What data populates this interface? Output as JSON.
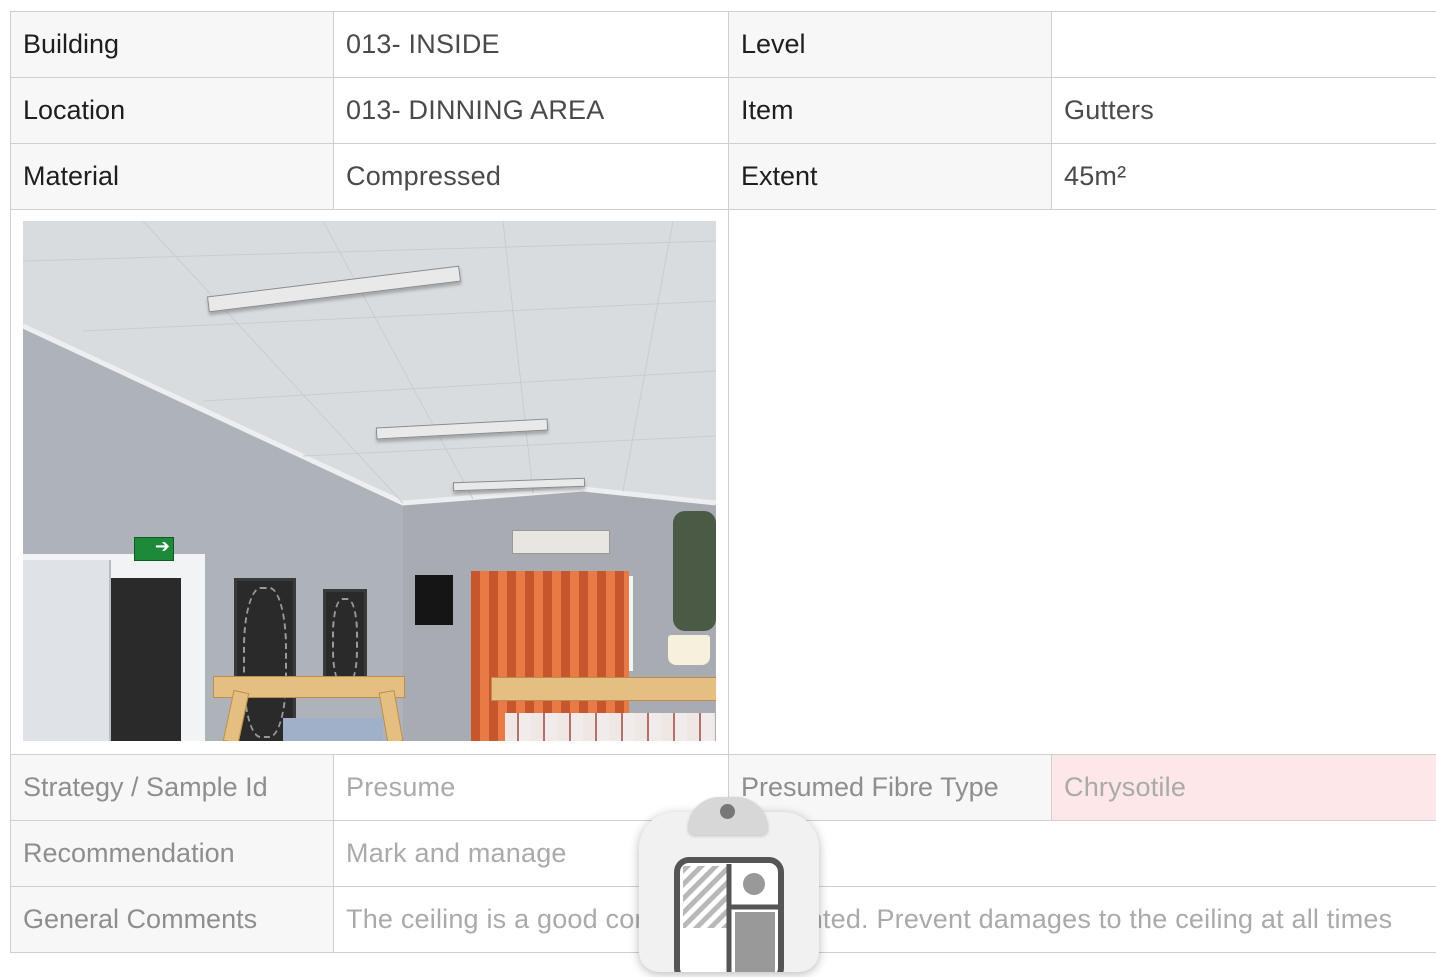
{
  "rows": {
    "building": {
      "label": "Building",
      "value": "013- INSIDE"
    },
    "level": {
      "label": "Level",
      "value": ""
    },
    "location": {
      "label": "Location",
      "value": "013- DINNING AREA"
    },
    "item": {
      "label": "Item",
      "value": "Gutters"
    },
    "material": {
      "label": "Material",
      "value": "Compressed"
    },
    "extent": {
      "label": "Extent",
      "value": "45m²"
    },
    "strategy": {
      "label": "Strategy / Sample Id",
      "value": "Presume"
    },
    "fibre_type": {
      "label": "Presumed Fibre Type",
      "value": "Chrysotile"
    },
    "recommendation": {
      "label": "Recommendation",
      "value": "Mark and manage"
    },
    "general_comments": {
      "label": "General Comments",
      "value": "The ceiling is a good con",
      "value_tail": "nted. Prevent damages to the ceiling at all times"
    }
  },
  "colors": {
    "label_bg": "#f7f7f7",
    "border": "#cfcfcf",
    "fibre_highlight": "#fde7e8"
  },
  "icons": {
    "overlay": "clipboard-icon"
  }
}
